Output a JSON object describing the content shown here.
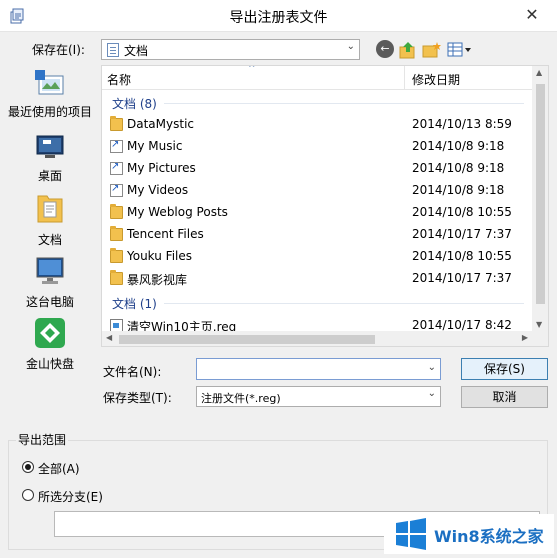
{
  "window": {
    "title": "导出注册表文件",
    "close_glyph": "✕"
  },
  "toolbar": {
    "lookin_label": "保存在(I):",
    "lookin_value": "文档",
    "back_glyph": "←"
  },
  "places": [
    {
      "label": "最近使用的项目",
      "icon": "recent-items-icon"
    },
    {
      "label": "桌面",
      "icon": "desktop-icon"
    },
    {
      "label": "文档",
      "icon": "documents-icon"
    },
    {
      "label": "这台电脑",
      "icon": "this-pc-icon"
    },
    {
      "label": "金山快盘",
      "icon": "kuaipan-icon"
    }
  ],
  "list": {
    "col_name": "名称",
    "col_date": "修改日期",
    "group1": "文档 (8)",
    "group2": "文档 (1)",
    "rows": [
      {
        "name": "DataMystic",
        "date": "2014/10/13 8:59",
        "icon": "folder-icon"
      },
      {
        "name": "My Music",
        "date": "2014/10/8 9:18",
        "icon": "shortcut-icon"
      },
      {
        "name": "My Pictures",
        "date": "2014/10/8 9:18",
        "icon": "shortcut-icon"
      },
      {
        "name": "My Videos",
        "date": "2014/10/8 9:18",
        "icon": "shortcut-icon"
      },
      {
        "name": "My Weblog Posts",
        "date": "2014/10/8 10:55",
        "icon": "folder-icon"
      },
      {
        "name": "Tencent Files",
        "date": "2014/10/17 7:37",
        "icon": "folder-icon"
      },
      {
        "name": "Youku Files",
        "date": "2014/10/8 10:55",
        "icon": "folder-icon"
      },
      {
        "name": "暴风影视库",
        "date": "2014/10/17 7:37",
        "icon": "folder-icon"
      },
      {
        "name": "清空Win10主页.reg",
        "date": "2014/10/17 8:42",
        "icon": "reg-file-icon"
      }
    ]
  },
  "form": {
    "filename_label": "文件名(N):",
    "filename_value": "",
    "filetype_label": "保存类型(T):",
    "filetype_value": "注册文件(*.reg)",
    "save_label": "保存(S)",
    "cancel_label": "取消"
  },
  "export_range": {
    "title": "导出范围",
    "all_label": "全部(A)",
    "selected_label": "所选分支(E)",
    "branch_value": ""
  },
  "watermark": {
    "text": "Win8系统之家"
  }
}
